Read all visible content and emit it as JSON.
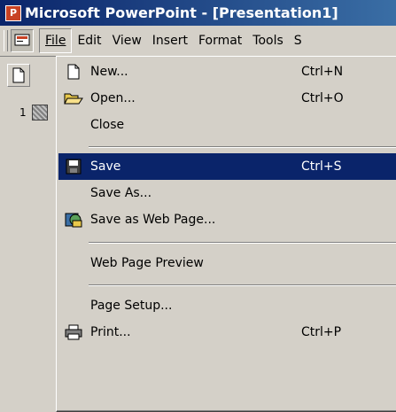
{
  "window": {
    "title": "Microsoft PowerPoint - [Presentation1]"
  },
  "menubar": {
    "items": [
      "File",
      "Edit",
      "View",
      "Insert",
      "Format",
      "Tools",
      "S"
    ]
  },
  "left_pane": {
    "slide_number": "1"
  },
  "file_menu": {
    "new": {
      "label": "New...",
      "shortcut": "Ctrl+N"
    },
    "open": {
      "label": "Open...",
      "shortcut": "Ctrl+O"
    },
    "close": {
      "label": "Close"
    },
    "save": {
      "label": "Save",
      "shortcut": "Ctrl+S"
    },
    "save_as": {
      "label": "Save As..."
    },
    "save_as_web": {
      "label": "Save as Web Page..."
    },
    "web_preview": {
      "label": "Web Page Preview"
    },
    "page_setup": {
      "label": "Page Setup..."
    },
    "print": {
      "label": "Print...",
      "shortcut": "Ctrl+P"
    }
  },
  "colors": {
    "titlebar": "#0a246a",
    "highlight": "#0a246a",
    "face": "#d4d0c8"
  },
  "icons": [
    "powerpoint-app-icon",
    "new-doc-icon",
    "open-folder-icon",
    "save-disk-icon",
    "web-page-icon",
    "printer-icon"
  ]
}
